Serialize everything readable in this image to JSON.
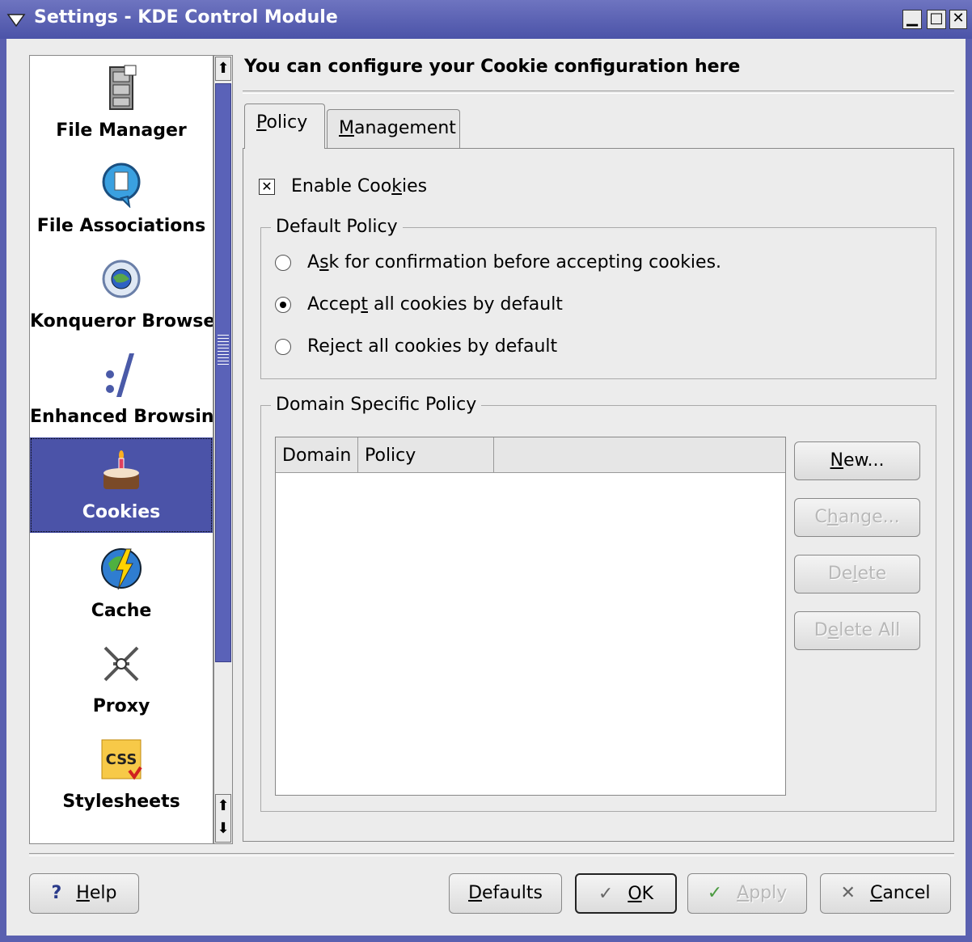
{
  "window": {
    "title": "Settings - KDE Control Module",
    "minimize_glyph": "▁",
    "maximize_glyph": "□",
    "close_glyph": "✕"
  },
  "sidebar": {
    "items": [
      {
        "label": "File Manager",
        "icon": "file-cabinet-icon"
      },
      {
        "label": "File Associations",
        "icon": "speech-bubble-document-icon"
      },
      {
        "label": "Konqueror Browser",
        "icon": "globe-gear-icon"
      },
      {
        "label": "Enhanced Browsing",
        "icon": "colon-slash-icon"
      },
      {
        "label": "Cookies",
        "icon": "cake-candle-icon",
        "selected": true
      },
      {
        "label": "Cache",
        "icon": "globe-lightning-icon"
      },
      {
        "label": "Proxy",
        "icon": "proxy-icon"
      },
      {
        "label": "Stylesheets",
        "icon": "css-icon"
      }
    ],
    "css_icon_text": "CSS"
  },
  "main": {
    "heading": "You can configure your Cookie configuration here",
    "tabs": [
      {
        "label": "Policy",
        "underline": "P",
        "rest": "olicy",
        "active": true
      },
      {
        "label": "Management",
        "underline": "M",
        "rest": "anagement",
        "active": false
      }
    ],
    "enable_cookies": {
      "pre": "Enable Coo",
      "underline": "k",
      "post": "ies",
      "checked": true
    },
    "default_policy": {
      "title": "Default Policy",
      "options": [
        {
          "pre": "A",
          "underline": "s",
          "post": "k for confirmation before accepting cookies.",
          "selected": false
        },
        {
          "pre": "Accep",
          "underline": "t",
          "post": " all cookies by default",
          "selected": true
        },
        {
          "pre": "Re",
          "underline": "j",
          "post": "ect all cookies by default",
          "selected": false
        }
      ]
    },
    "domain_policy": {
      "title": "Domain Specific Policy",
      "columns": [
        "Domain",
        "Policy"
      ],
      "rows": [],
      "buttons": [
        {
          "pre": "",
          "underline": "N",
          "post": "ew...",
          "enabled": true
        },
        {
          "pre": "C",
          "underline": "h",
          "post": "ange...",
          "enabled": false
        },
        {
          "pre": "De",
          "underline": "l",
          "post": "ete",
          "enabled": false
        },
        {
          "pre": "D",
          "underline": "e",
          "post": "lete All",
          "enabled": false
        }
      ]
    }
  },
  "footer": {
    "help": {
      "pre": "",
      "underline": "H",
      "post": "elp"
    },
    "defaults": {
      "pre": "",
      "underline": "D",
      "post": "efaults"
    },
    "ok": {
      "pre": "",
      "underline": "O",
      "post": "K"
    },
    "apply": {
      "pre": "",
      "underline": "A",
      "post": "pply"
    },
    "cancel": {
      "pre": "",
      "underline": "C",
      "post": "ancel"
    }
  },
  "colors": {
    "titlebar": "#4b53a8",
    "selection": "#4b53a8",
    "background": "#ececec"
  }
}
